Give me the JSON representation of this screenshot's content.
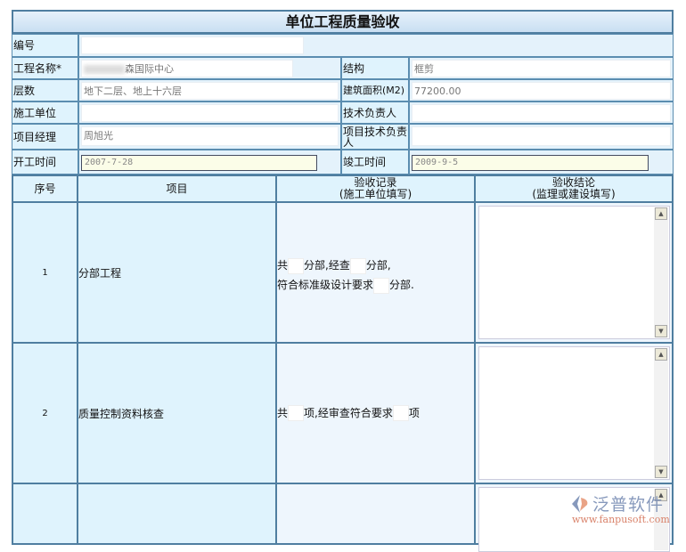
{
  "title": "单位工程质量验收",
  "fields": {
    "number": {
      "label": "编号",
      "value": ""
    },
    "project_name": {
      "label": "工程名称*",
      "value": "森国际中心"
    },
    "structure": {
      "label": "结构",
      "value": "框剪"
    },
    "floors": {
      "label": "层数",
      "value": "地下二层、地上十六层"
    },
    "area": {
      "label": "建筑面积(M2)",
      "value": "77200.00"
    },
    "contractor": {
      "label": "施工单位",
      "value": ""
    },
    "tech_lead": {
      "label": "技术负责人",
      "value": ""
    },
    "pm": {
      "label": "项目经理",
      "value": "周旭光"
    },
    "project_tech_lead": {
      "label": "项目技术负责人",
      "value": ""
    },
    "start": {
      "label": "开工时间",
      "value": "2007-7-28"
    },
    "end": {
      "label": "竣工时间",
      "value": "2009-9-5"
    }
  },
  "table": {
    "headers": [
      "序号",
      "项目",
      "验收记录",
      "(施工单位填写)",
      "验收结论",
      "(监理或建设填写)"
    ],
    "rows": [
      {
        "no": "1",
        "item": "分部工程",
        "t1": "共",
        "t2": "分部,经查",
        "t3": "分部,",
        "t4": "符合标准级设计要求",
        "t5": "分部."
      },
      {
        "no": "2",
        "item": "质量控制资料核查",
        "t1": "共",
        "t2": "项,经审查符合要求",
        "t3": "项"
      }
    ]
  },
  "watermark": {
    "brand": "泛普软件",
    "url": "www.fanpusoft.com"
  }
}
